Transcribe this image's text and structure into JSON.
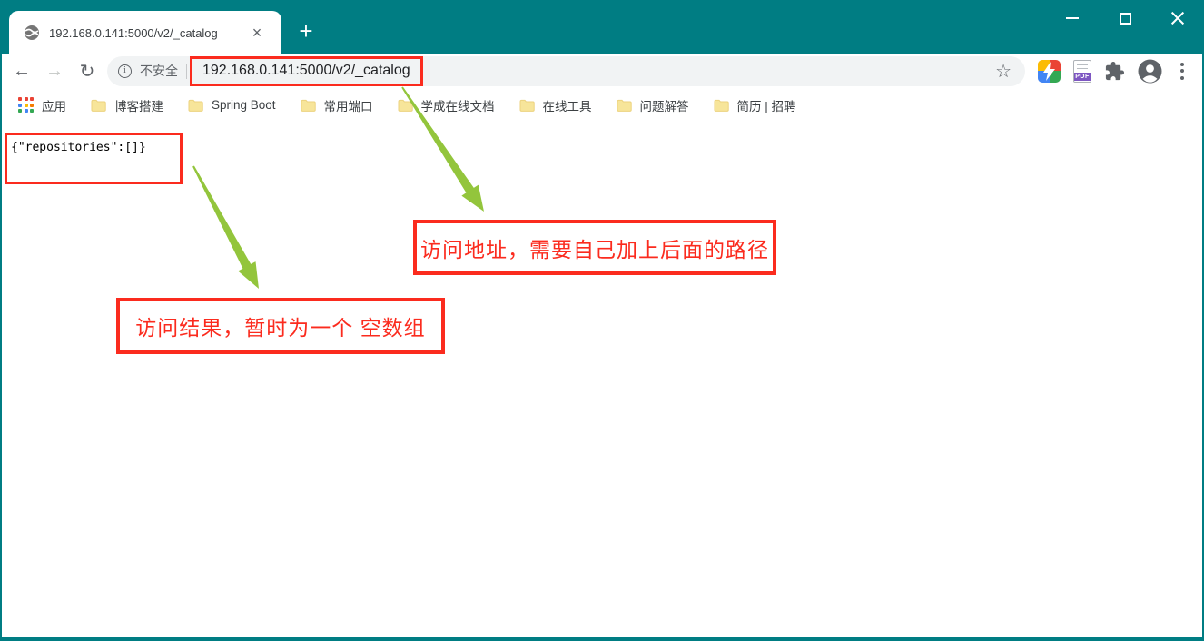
{
  "tab": {
    "title": "192.168.0.141:5000/v2/_catalog"
  },
  "toolbar": {
    "security_label": "不安全",
    "url": "192.168.0.141:5000/v2/_catalog",
    "pdf_badge_label": "PDF"
  },
  "icons": {
    "back": "←",
    "forward": "→",
    "reload": "↻",
    "info": "i",
    "star": "☆",
    "tab_close": "×",
    "new_tab": "+"
  },
  "bookmarks": {
    "items": [
      {
        "label": "应用"
      },
      {
        "label": "博客搭建"
      },
      {
        "label": "Spring Boot"
      },
      {
        "label": "常用端口"
      },
      {
        "label": "学成在线文档"
      },
      {
        "label": "在线工具"
      },
      {
        "label": "问题解答"
      },
      {
        "label": "简历 | 招聘"
      }
    ]
  },
  "content": {
    "response_text": "{\"repositories\":[]}",
    "callouts": [
      {
        "text": "访问地址，需要自己加上后面的路径"
      },
      {
        "text": "访问结果，暂时为一个 空数组"
      }
    ]
  },
  "colors": {
    "theme_teal": "#007d83",
    "annotation_red": "#fb2b1e",
    "arrow_green": "#93c53c"
  }
}
